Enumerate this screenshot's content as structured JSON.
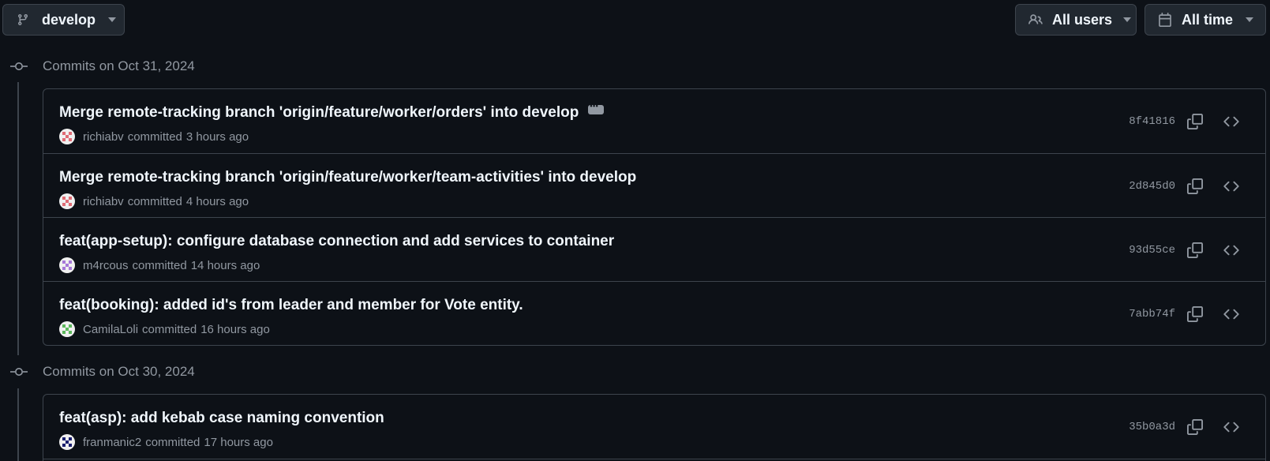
{
  "filters": {
    "branch": "develop",
    "users": "All users",
    "time": "All time"
  },
  "groups": [
    {
      "date_label": "Commits on Oct 31, 2024",
      "commits": [
        {
          "message": "Merge remote-tracking branch 'origin/feature/worker/orders' into develop",
          "author": "richiabv",
          "verb": "committed",
          "time": "3 hours ago",
          "sha": "8f41816",
          "has_ellipsis": true,
          "avatar_color": "#e06c75"
        },
        {
          "message": "Merge remote-tracking branch 'origin/feature/worker/team-activities' into develop",
          "author": "richiabv",
          "verb": "committed",
          "time": "4 hours ago",
          "sha": "2d845d0",
          "has_ellipsis": false,
          "avatar_color": "#e06c75"
        },
        {
          "message": "feat(app-setup): configure database connection and add services to container",
          "author": "m4rcous",
          "verb": "committed",
          "time": "14 hours ago",
          "sha": "93d55ce",
          "has_ellipsis": false,
          "avatar_color": "#a678d8"
        },
        {
          "message": "feat(booking): added id's from leader and member for Vote entity.",
          "author": "CamilaLoli",
          "verb": "committed",
          "time": "16 hours ago",
          "sha": "7abb74f",
          "has_ellipsis": false,
          "avatar_color": "#5cb85c"
        }
      ]
    },
    {
      "date_label": "Commits on Oct 30, 2024",
      "commits": [
        {
          "message": "feat(asp): add kebab case naming convention",
          "author": "franmanic2",
          "verb": "committed",
          "time": "17 hours ago",
          "sha": "35b0a3d",
          "has_ellipsis": false,
          "avatar_color": "#1a1f6e"
        }
      ]
    }
  ],
  "icons": {
    "branch": "git-branch-icon",
    "users": "people-icon",
    "time": "calendar-icon",
    "commit": "git-commit-icon",
    "copy": "copy-icon",
    "browse": "code-icon"
  }
}
